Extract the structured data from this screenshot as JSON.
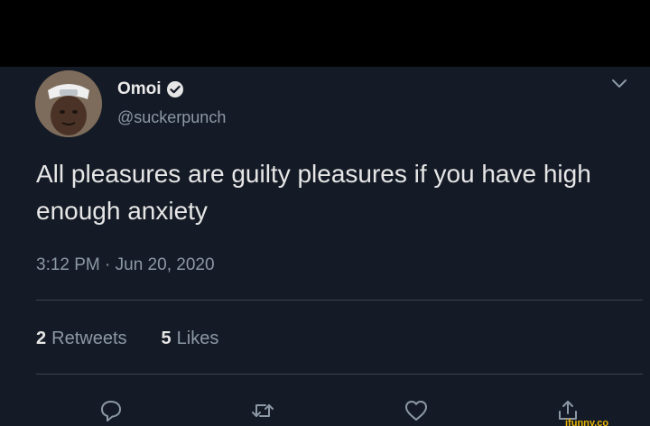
{
  "tweet": {
    "author": {
      "display_name": "Omoi",
      "handle": "@suckerpunch",
      "verified": true
    },
    "text": "All pleasures are guilty pleasures if you have high enough anxiety",
    "timestamp": "3:12 PM · Jun 20, 2020",
    "stats": {
      "retweets_count": "2",
      "retweets_label": "Retweets",
      "likes_count": "5",
      "likes_label": "Likes"
    }
  },
  "icons": {
    "verified": "verified-badge-icon",
    "menu": "chevron-down-icon",
    "reply": "reply-icon",
    "retweet": "retweet-icon",
    "like": "heart-icon",
    "share": "share-icon"
  },
  "watermark": "ifunny.co",
  "colors": {
    "background": "#151b26",
    "text_primary": "#e6e6e6",
    "text_secondary": "#8b98a5",
    "divider": "#38444d",
    "watermark": "#e8b400"
  }
}
